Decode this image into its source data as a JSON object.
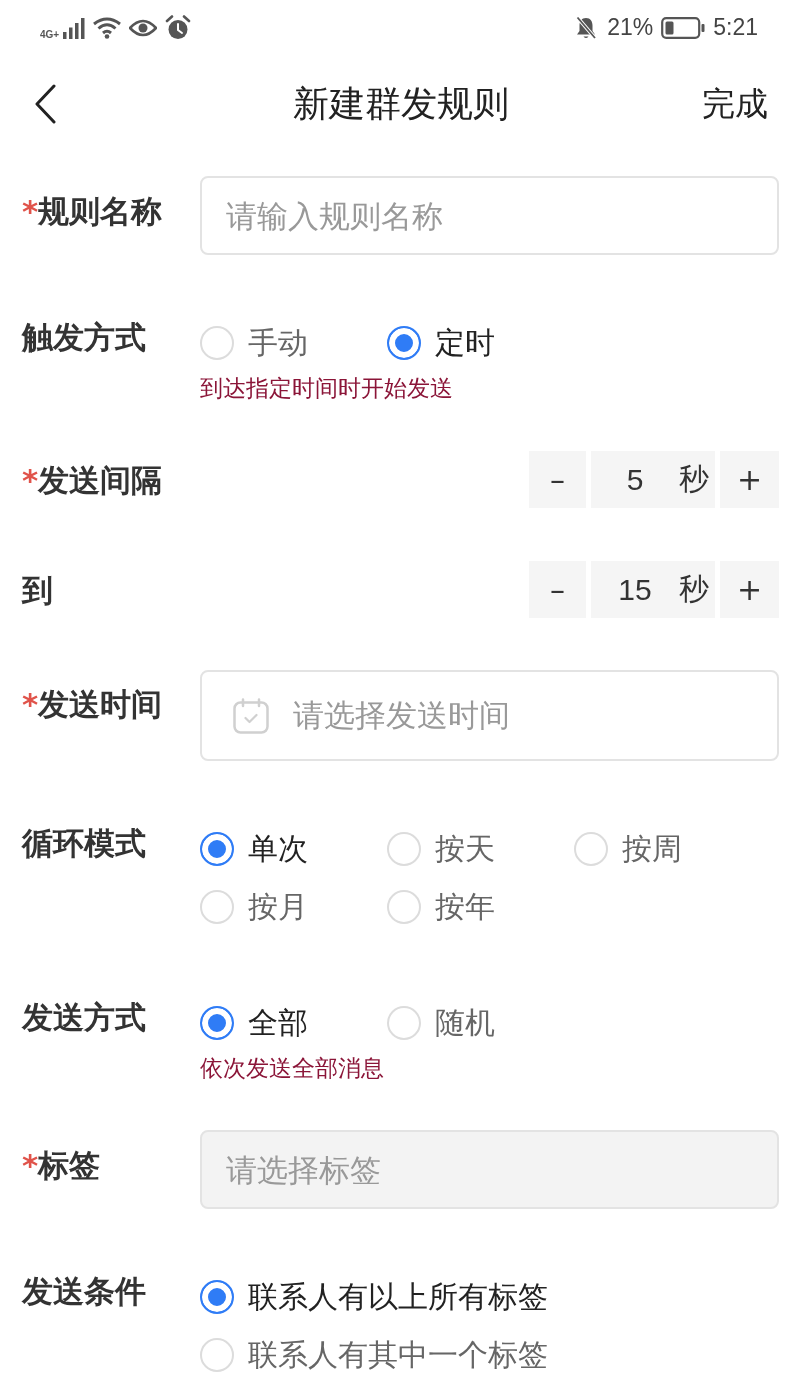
{
  "status_bar": {
    "network": "4G+",
    "battery_percent": "21%",
    "time": "5:21"
  },
  "nav": {
    "title": "新建群发规则",
    "action": "完成"
  },
  "fields": [
    {
      "kind": "input",
      "required_mark": "*",
      "label": "规则名称",
      "placeholder": "请输入规则名称"
    },
    {
      "kind": "radio",
      "label": "触发方式",
      "options": [
        {
          "label": "手动",
          "selected": false
        },
        {
          "label": "定时",
          "selected": true
        }
      ],
      "hint": "到达指定时间时开始发送"
    },
    {
      "kind": "stepper",
      "required_mark": "*",
      "label": "发送间隔",
      "decrement": "–",
      "value": "5",
      "unit": "秒",
      "increment": "+"
    },
    {
      "kind": "stepper",
      "label": "到",
      "decrement": "–",
      "value": "15",
      "unit": "秒",
      "increment": "+"
    },
    {
      "kind": "date",
      "required_mark": "*",
      "label": "发送时间",
      "placeholder": "请选择发送时间"
    },
    {
      "kind": "radio",
      "label": "循环模式",
      "options": [
        {
          "label": "单次",
          "selected": true
        },
        {
          "label": "按天",
          "selected": false
        },
        {
          "label": "按周",
          "selected": false
        },
        {
          "label": "按月",
          "selected": false
        },
        {
          "label": "按年",
          "selected": false
        }
      ]
    },
    {
      "kind": "radio",
      "label": "发送方式",
      "options": [
        {
          "label": "全部",
          "selected": true
        },
        {
          "label": "随机",
          "selected": false
        }
      ],
      "hint": "依次发送全部消息"
    },
    {
      "kind": "select",
      "required_mark": "*",
      "label": "标签",
      "placeholder": "请选择标签"
    },
    {
      "kind": "radio",
      "label": "发送条件",
      "options": [
        {
          "label": "联系人有以上所有标签",
          "selected": true
        },
        {
          "label": "联系人有其中一个标签",
          "selected": false
        }
      ]
    }
  ]
}
